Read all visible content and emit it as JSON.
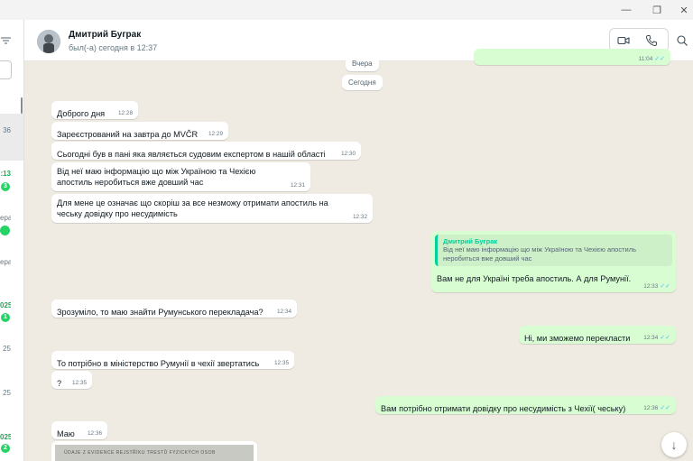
{
  "window": {
    "minimize": "—",
    "maximize": "❐",
    "close": "✕"
  },
  "sidebar": {
    "fragments": [
      "36",
      ":13",
      "3",
      "ера",
      "ера",
      "025",
      "1",
      "25",
      "25",
      "025",
      "2"
    ]
  },
  "header": {
    "contact_name": "Дмитрий Буграк",
    "status": "был(-а) сегодня в 12:37",
    "icons": [
      "video-call-icon",
      "voice-call-icon",
      "search-icon"
    ]
  },
  "colors": {
    "outgoing": "#d9fdd3",
    "incoming": "#ffffff",
    "read_ticks": "#53bdeb",
    "accent": "#06cf9c"
  },
  "chat": {
    "partial_top_time": "11:04",
    "date_pills": {
      "yesterday": "Вчера",
      "today": "Сегодня"
    },
    "messages": [
      {
        "dir": "in",
        "text": "Доброго дня",
        "time": "12:28"
      },
      {
        "dir": "in",
        "text": "Зареєстрований на завтра до MVČR",
        "time": "12:29"
      },
      {
        "dir": "in",
        "text": "Сьогодні був в пані яка являється судовим експертом в нашій області",
        "time": "12:30"
      },
      {
        "dir": "in",
        "text": "Від неї маю інформацію що між Україною та Чехією апостиль неробиться вже довший час",
        "time": "12:31"
      },
      {
        "dir": "in",
        "text": "Для мене це означає що скоріш за все незможу отримати апостиль на чеську довідку про несудимість",
        "time": "12:32"
      },
      {
        "dir": "out",
        "quote_name": "Дмитрий Буграк",
        "quote_text": "Від неї маю інформацію що між Україною та Чехією апостиль неробиться вже довший час",
        "text": "Вам не для Україні треба апостиль. А для Румунії.",
        "time": "12:33"
      },
      {
        "dir": "in",
        "text": "Зрозуміло, то маю знайти Румунського перекладача?",
        "time": "12:34"
      },
      {
        "dir": "out",
        "text": "Ні, ми зможемо перекласти",
        "time": "12:34"
      },
      {
        "dir": "in",
        "text": "То потрібно в міністерство Румунії в чехії звертатись",
        "time": "12:35"
      },
      {
        "dir": "in",
        "text": "?",
        "time": "12:35"
      },
      {
        "dir": "out",
        "text": "Вам потрібно отримати довідку про несудимість  з Чехії( чеську)",
        "time": "12:36"
      },
      {
        "dir": "in",
        "text": "Маю",
        "time": "12:36"
      }
    ],
    "document_preview_text": "ÚDAJE Z EVIDENCE REJSTŘÍKU TRESTŮ FYZICKÝCH OSOB",
    "scroll_down_icon": "↓"
  }
}
